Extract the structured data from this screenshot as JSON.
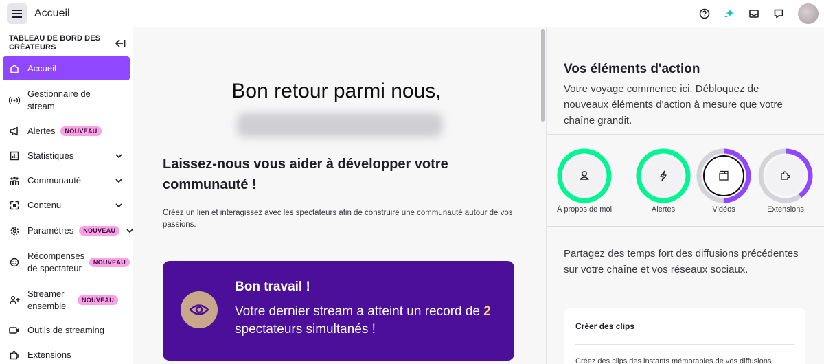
{
  "topbar": {
    "title": "Accueil",
    "icons": [
      "help-icon",
      "sparkle-icon",
      "inbox-icon",
      "whispers-icon",
      "avatar"
    ]
  },
  "sidebar": {
    "header": "TABLEAU DE BORD DES CRÉATEURS",
    "items": [
      {
        "label": "Accueil",
        "icon": "home-icon",
        "active": true
      },
      {
        "label": "Gestionnaire de stream",
        "icon": "broadcast-icon"
      },
      {
        "label": "Alertes",
        "icon": "megaphone-icon",
        "badge": "NOUVEAU"
      },
      {
        "label": "Statistiques",
        "icon": "stats-icon",
        "expandable": true
      },
      {
        "label": "Communauté",
        "icon": "community-icon",
        "expandable": true
      },
      {
        "label": "Contenu",
        "icon": "content-icon",
        "expandable": true
      },
      {
        "label": "Paramètres",
        "icon": "settings-icon",
        "badge": "NOUVEAU",
        "expandable": true
      },
      {
        "label": "Récompenses de spectateur",
        "icon": "rewards-icon",
        "badge": "NOUVEAU"
      },
      {
        "label": "Streamer ensemble",
        "icon": "add-user-icon",
        "badge": "NOUVEAU"
      },
      {
        "label": "Outils de streaming",
        "icon": "camera-icon"
      },
      {
        "label": "Extensions",
        "icon": "puzzle-icon"
      }
    ]
  },
  "main": {
    "welcome": "Bon retour parmi nous,",
    "help_title": "Laissez-nous vous aider à développer votre communauté !",
    "help_desc": "Créez un lien et interagissez avec les spectateurs afin de construire une communauté autour de vos passions.",
    "congrats": {
      "title": "Bon travail !",
      "text_before": "Votre dernier stream a atteint un record de ",
      "number": "2",
      "text_after": " spectateurs simultanés !"
    }
  },
  "right_panel": {
    "title": "Vos éléments d'action",
    "subtitle": "Votre voyage commence ici. Débloquez de nouveaux éléments d'action à mesure que votre chaîne grandit.",
    "actions": [
      {
        "label": "À propos de moi",
        "icon": "user-icon",
        "progress": 1.0,
        "color": "#00f593"
      },
      {
        "label": "Alertes",
        "icon": "alert-icon",
        "progress": 1.0,
        "color": "#00f593"
      },
      {
        "label": "Vidéos",
        "icon": "clapper-icon",
        "progress": 0.5,
        "color": "#9147ff"
      },
      {
        "label": "Extensions",
        "icon": "puzzle-icon",
        "progress": 0.4,
        "color": "#9147ff"
      }
    ],
    "share_text": "Partagez des temps fort des diffusions précédentes sur votre chaîne et vos réseaux sociaux.",
    "clip_card": {
      "title": "Créer des clips",
      "desc": "Créez des clips des instants mémorables de vos diffusions"
    }
  },
  "colors": {
    "accent": "#9147ff",
    "badge": "#f9a3e6",
    "banner": "#4b0f9a",
    "progress_green": "#00f593",
    "highlight": "#fcd36b"
  }
}
